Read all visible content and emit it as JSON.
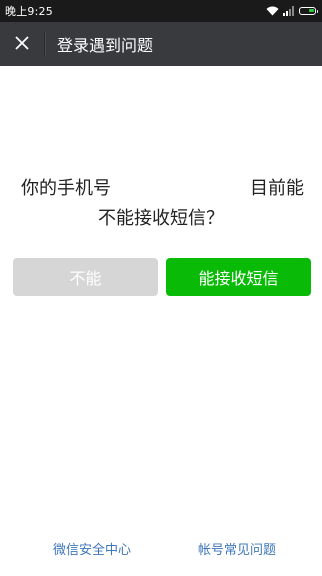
{
  "status_bar": {
    "time": "晚上9:25"
  },
  "nav": {
    "title": "登录遇到问题",
    "close_icon": "close-icon"
  },
  "question": {
    "line1_left": "你的手机号",
    "line1_right": "目前能",
    "line2": "不能接收短信？"
  },
  "buttons": {
    "no_label": "不能",
    "yes_label": "能接收短信"
  },
  "footer": {
    "security_center": "微信安全中心",
    "account_faq": "帐号常见问题"
  },
  "colors": {
    "nav_bg": "#393a3e",
    "primary_green": "#09bb07",
    "disabled_gray": "#d6d6d6",
    "link_blue": "#3e76b8"
  }
}
